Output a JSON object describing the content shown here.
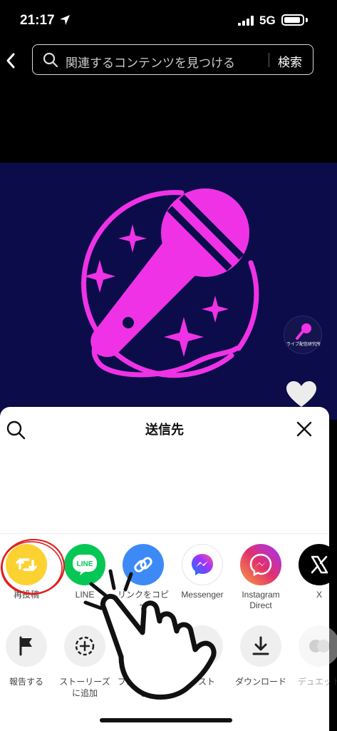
{
  "status_bar": {
    "time": "21:17",
    "network": "5G",
    "battery_level": 0.9
  },
  "header": {
    "search_placeholder": "関連するコンテンツを見つける",
    "search_button": "検索"
  },
  "video": {
    "watermark_text": "ライブ配信研究所",
    "colors": {
      "background": "#0c0c4a",
      "microphone": "#f032e6"
    }
  },
  "share_sheet": {
    "title": "送信先",
    "share_targets": [
      {
        "label": "再投稿",
        "icon": "repost-icon",
        "color": "#fbd231"
      },
      {
        "label": "LINE",
        "icon": "line-icon",
        "color": "#06c755",
        "badge": "LINE"
      },
      {
        "label": "リンクをコピー",
        "icon": "link-icon",
        "color": "#3d8af7"
      },
      {
        "label": "Messenger",
        "icon": "messenger-icon",
        "color": "#ffffff"
      },
      {
        "label": "Instagram Direct",
        "icon": "instagram-direct-icon",
        "color": "#e1306c"
      },
      {
        "label": "X",
        "icon": "x-logo-icon",
        "color": "#000000"
      }
    ],
    "actions": [
      {
        "label": "報告する",
        "icon": "flag-icon"
      },
      {
        "label": "ストーリーズに追加",
        "icon": "story-add-icon"
      },
      {
        "label": "プロモートする",
        "icon": "promote-icon"
      },
      {
        "label": "リスト",
        "icon": "list-icon"
      },
      {
        "label": "ダウンロード",
        "icon": "download-icon"
      },
      {
        "label": "デュエット",
        "icon": "duet-icon"
      }
    ]
  }
}
